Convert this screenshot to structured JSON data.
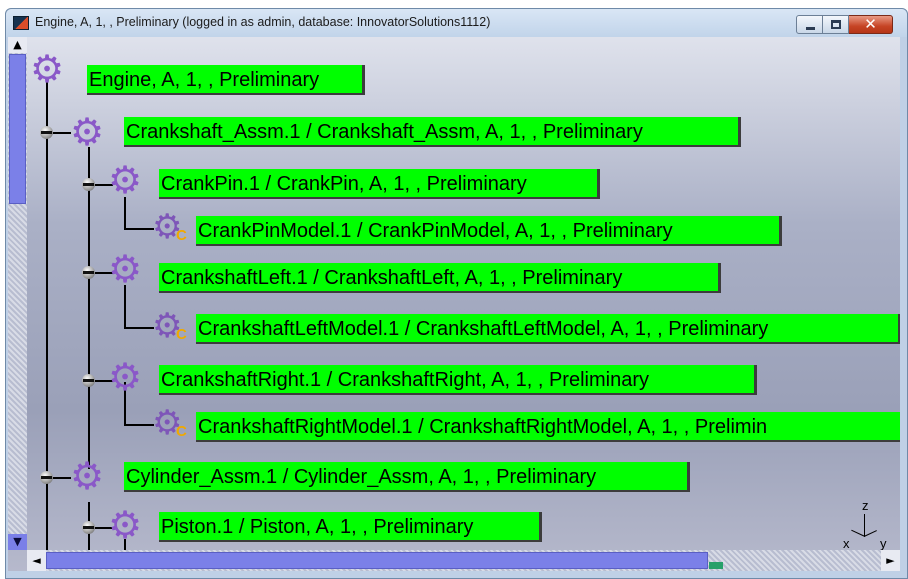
{
  "window": {
    "title": "Engine, A, 1, , Preliminary (logged in as admin, database: InnovatorSolutions1112)",
    "buttons": {
      "minimize_icon": "minimize-icon",
      "maximize_icon": "maximize-icon",
      "close_icon": "close-icon"
    }
  },
  "tree": {
    "nodes": [
      {
        "label": "Engine, A, 1, , Preliminary",
        "icon": "gear-icon",
        "level": 0
      },
      {
        "label": "Crankshaft_Assm.1 / Crankshaft_Assm, A, 1, , Preliminary",
        "icon": "gear-icon",
        "level": 1,
        "expanded": true
      },
      {
        "label": "CrankPin.1 / CrankPin, A, 1, , Preliminary",
        "icon": "gear-icon",
        "level": 2,
        "expanded": true
      },
      {
        "label": "CrankPinModel.1 / CrankPinModel, A, 1, , Preliminary",
        "icon": "cad-model-icon",
        "level": 3
      },
      {
        "label": "CrankshaftLeft.1 / CrankshaftLeft, A, 1, , Preliminary",
        "icon": "gear-icon",
        "level": 2,
        "expanded": true
      },
      {
        "label": "CrankshaftLeftModel.1 / CrankshaftLeftModel, A, 1, , Preliminary",
        "icon": "cad-model-icon",
        "level": 3
      },
      {
        "label": "CrankshaftRight.1 / CrankshaftRight, A, 1, , Preliminary",
        "icon": "gear-icon",
        "level": 2,
        "expanded": true
      },
      {
        "label": "CrankshaftRightModel.1 / CrankshaftRightModel, A, 1, , Prelimin",
        "icon": "cad-model-icon",
        "level": 3
      },
      {
        "label": "Cylinder_Assm.1 / Cylinder_Assm, A, 1, , Preliminary",
        "icon": "gear-icon",
        "level": 1,
        "expanded": true
      },
      {
        "label": "Piston.1 / Piston, A, 1, , Preliminary",
        "icon": "gear-icon",
        "level": 2,
        "expanded": true
      }
    ],
    "model_badge": "C"
  },
  "compass": {
    "z": "z",
    "x": "x",
    "y": "y"
  },
  "scroll": {
    "up": "▲",
    "down": "▼",
    "left": "◄",
    "right": "►"
  },
  "colors": {
    "label_bg": "#00ff00",
    "gear": "#8a58c8",
    "badge": "#f0a800",
    "scroll_thumb": "#7b80e8"
  }
}
